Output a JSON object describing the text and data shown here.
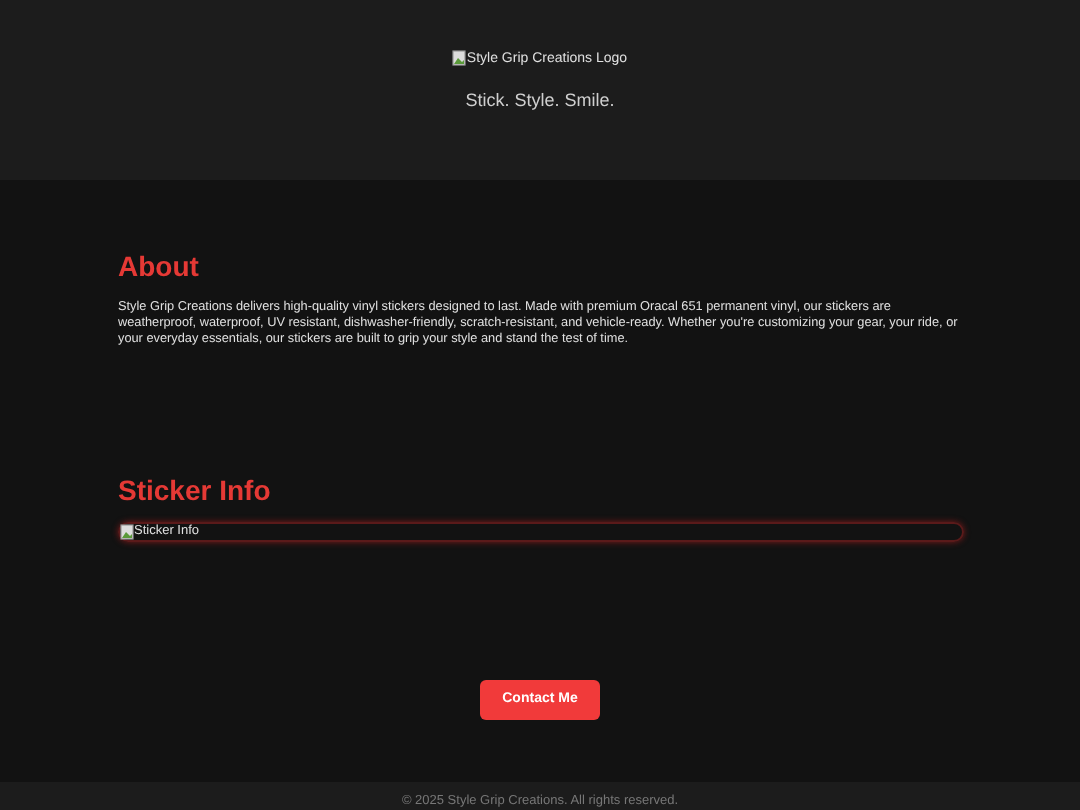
{
  "header": {
    "logo_alt": "Style Grip Creations Logo",
    "tagline": "Stick. Style. Smile."
  },
  "about": {
    "heading": "About",
    "text": "Style Grip Creations delivers high-quality vinyl stickers designed to last. Made with premium Oracal 651 permanent vinyl, our stickers are weatherproof, waterproof, UV resistant, dishwasher-friendly, scratch-resistant, and vehicle-ready. Whether you're customizing your gear, your ride, or your everyday essentials, our stickers are built to grip your style and stand the test of time."
  },
  "sticker_info": {
    "heading": "Sticker Info",
    "image_alt": "Sticker Info"
  },
  "contact_button": "Contact Me",
  "footer": "© 2025 Style Grip Creations. All rights reserved."
}
